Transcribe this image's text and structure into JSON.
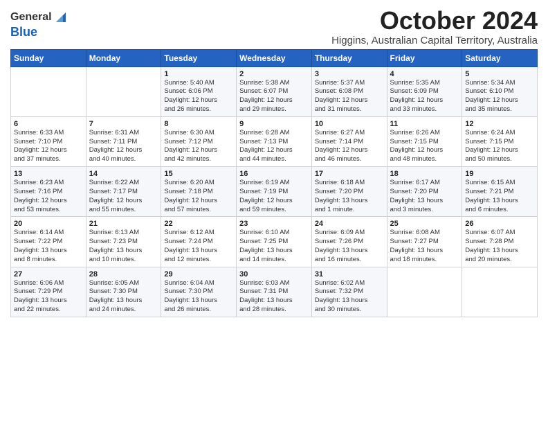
{
  "logo": {
    "general": "General",
    "blue": "Blue"
  },
  "title": "October 2024",
  "subtitle": "Higgins, Australian Capital Territory, Australia",
  "days_of_week": [
    "Sunday",
    "Monday",
    "Tuesday",
    "Wednesday",
    "Thursday",
    "Friday",
    "Saturday"
  ],
  "weeks": [
    [
      {
        "day": "",
        "info": ""
      },
      {
        "day": "",
        "info": ""
      },
      {
        "day": "1",
        "info": "Sunrise: 5:40 AM\nSunset: 6:06 PM\nDaylight: 12 hours\nand 26 minutes."
      },
      {
        "day": "2",
        "info": "Sunrise: 5:38 AM\nSunset: 6:07 PM\nDaylight: 12 hours\nand 29 minutes."
      },
      {
        "day": "3",
        "info": "Sunrise: 5:37 AM\nSunset: 6:08 PM\nDaylight: 12 hours\nand 31 minutes."
      },
      {
        "day": "4",
        "info": "Sunrise: 5:35 AM\nSunset: 6:09 PM\nDaylight: 12 hours\nand 33 minutes."
      },
      {
        "day": "5",
        "info": "Sunrise: 5:34 AM\nSunset: 6:10 PM\nDaylight: 12 hours\nand 35 minutes."
      }
    ],
    [
      {
        "day": "6",
        "info": "Sunrise: 6:33 AM\nSunset: 7:10 PM\nDaylight: 12 hours\nand 37 minutes."
      },
      {
        "day": "7",
        "info": "Sunrise: 6:31 AM\nSunset: 7:11 PM\nDaylight: 12 hours\nand 40 minutes."
      },
      {
        "day": "8",
        "info": "Sunrise: 6:30 AM\nSunset: 7:12 PM\nDaylight: 12 hours\nand 42 minutes."
      },
      {
        "day": "9",
        "info": "Sunrise: 6:28 AM\nSunset: 7:13 PM\nDaylight: 12 hours\nand 44 minutes."
      },
      {
        "day": "10",
        "info": "Sunrise: 6:27 AM\nSunset: 7:14 PM\nDaylight: 12 hours\nand 46 minutes."
      },
      {
        "day": "11",
        "info": "Sunrise: 6:26 AM\nSunset: 7:15 PM\nDaylight: 12 hours\nand 48 minutes."
      },
      {
        "day": "12",
        "info": "Sunrise: 6:24 AM\nSunset: 7:15 PM\nDaylight: 12 hours\nand 50 minutes."
      }
    ],
    [
      {
        "day": "13",
        "info": "Sunrise: 6:23 AM\nSunset: 7:16 PM\nDaylight: 12 hours\nand 53 minutes."
      },
      {
        "day": "14",
        "info": "Sunrise: 6:22 AM\nSunset: 7:17 PM\nDaylight: 12 hours\nand 55 minutes."
      },
      {
        "day": "15",
        "info": "Sunrise: 6:20 AM\nSunset: 7:18 PM\nDaylight: 12 hours\nand 57 minutes."
      },
      {
        "day": "16",
        "info": "Sunrise: 6:19 AM\nSunset: 7:19 PM\nDaylight: 12 hours\nand 59 minutes."
      },
      {
        "day": "17",
        "info": "Sunrise: 6:18 AM\nSunset: 7:20 PM\nDaylight: 13 hours\nand 1 minute."
      },
      {
        "day": "18",
        "info": "Sunrise: 6:17 AM\nSunset: 7:20 PM\nDaylight: 13 hours\nand 3 minutes."
      },
      {
        "day": "19",
        "info": "Sunrise: 6:15 AM\nSunset: 7:21 PM\nDaylight: 13 hours\nand 6 minutes."
      }
    ],
    [
      {
        "day": "20",
        "info": "Sunrise: 6:14 AM\nSunset: 7:22 PM\nDaylight: 13 hours\nand 8 minutes."
      },
      {
        "day": "21",
        "info": "Sunrise: 6:13 AM\nSunset: 7:23 PM\nDaylight: 13 hours\nand 10 minutes."
      },
      {
        "day": "22",
        "info": "Sunrise: 6:12 AM\nSunset: 7:24 PM\nDaylight: 13 hours\nand 12 minutes."
      },
      {
        "day": "23",
        "info": "Sunrise: 6:10 AM\nSunset: 7:25 PM\nDaylight: 13 hours\nand 14 minutes."
      },
      {
        "day": "24",
        "info": "Sunrise: 6:09 AM\nSunset: 7:26 PM\nDaylight: 13 hours\nand 16 minutes."
      },
      {
        "day": "25",
        "info": "Sunrise: 6:08 AM\nSunset: 7:27 PM\nDaylight: 13 hours\nand 18 minutes."
      },
      {
        "day": "26",
        "info": "Sunrise: 6:07 AM\nSunset: 7:28 PM\nDaylight: 13 hours\nand 20 minutes."
      }
    ],
    [
      {
        "day": "27",
        "info": "Sunrise: 6:06 AM\nSunset: 7:29 PM\nDaylight: 13 hours\nand 22 minutes."
      },
      {
        "day": "28",
        "info": "Sunrise: 6:05 AM\nSunset: 7:30 PM\nDaylight: 13 hours\nand 24 minutes."
      },
      {
        "day": "29",
        "info": "Sunrise: 6:04 AM\nSunset: 7:30 PM\nDaylight: 13 hours\nand 26 minutes."
      },
      {
        "day": "30",
        "info": "Sunrise: 6:03 AM\nSunset: 7:31 PM\nDaylight: 13 hours\nand 28 minutes."
      },
      {
        "day": "31",
        "info": "Sunrise: 6:02 AM\nSunset: 7:32 PM\nDaylight: 13 hours\nand 30 minutes."
      },
      {
        "day": "",
        "info": ""
      },
      {
        "day": "",
        "info": ""
      }
    ]
  ]
}
